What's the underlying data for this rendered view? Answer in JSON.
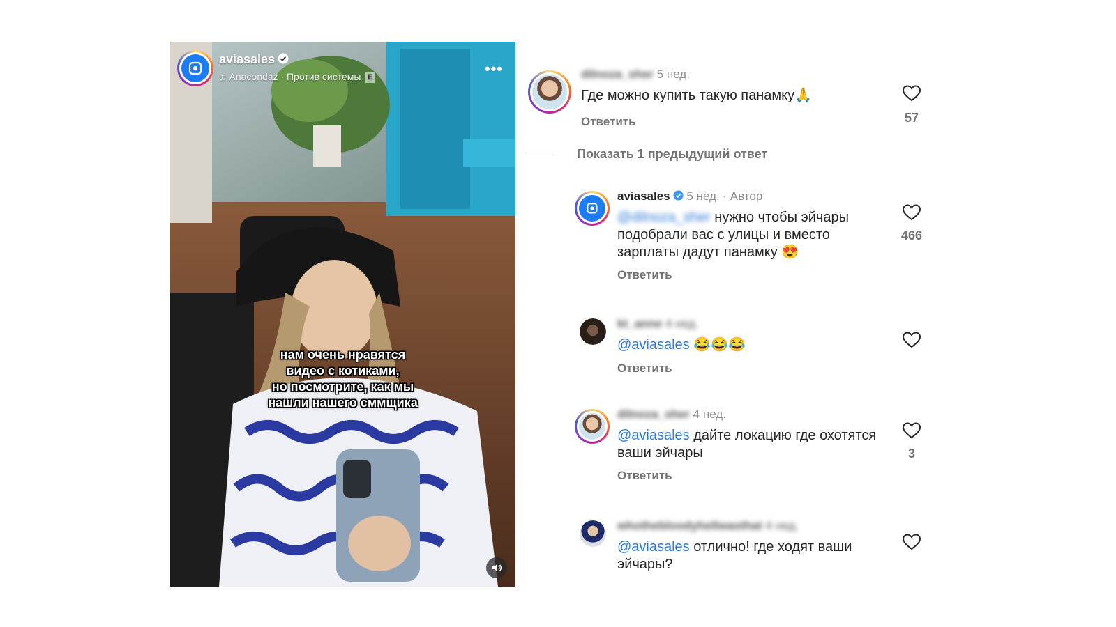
{
  "video": {
    "username": "aviasales",
    "music": "Anacondaz · Против системы",
    "explicit_badge": "E",
    "more_icon": "more-horizontal-icon",
    "caption": "нам очень нравятся\nвидео с котиками,\nно посмотрите, как мы\nнашли нашего сммщика",
    "mute_icon": "speaker-icon"
  },
  "comments": [
    {
      "author": "dilnoza_sher",
      "time": "5 нед.",
      "text": "Где можно купить такую панамку",
      "emoji": "🙏",
      "reply_label": "Ответить",
      "likes": "57"
    }
  ],
  "show_previous": "Показать 1 предыдущий ответ",
  "replies": [
    {
      "author": "aviasales",
      "time": "5 нед.",
      "author_tag": "Автор",
      "mention": "@dilnoza_sher",
      "text": "нужно чтобы эйчары подобрали вас с улицы и вместо зарплаты дадут панамку",
      "emoji": "😍",
      "reply_label": "Ответить",
      "likes": "466"
    },
    {
      "author": "kt_anne",
      "time": "4 нед.",
      "mention": "@aviasales",
      "text": "",
      "emoji": "😂😂😂",
      "reply_label": "Ответить",
      "likes": ""
    },
    {
      "author": "dilnoza_sher",
      "time": "4 нед.",
      "mention": "@aviasales",
      "text": "дайте локацию где охотятся ваши эйчары",
      "emoji": "",
      "reply_label": "Ответить",
      "likes": "3"
    },
    {
      "author": "whothebloodyhellwasthat",
      "time": "4 нед.",
      "mention": "@aviasales",
      "text": "отлично! где ходят ваши эйчары?",
      "emoji": "",
      "reply_label": "",
      "likes": ""
    }
  ],
  "colors": {
    "accent": "#2f7bd8",
    "brand": "#1e7cf2",
    "muted": "#737373"
  }
}
